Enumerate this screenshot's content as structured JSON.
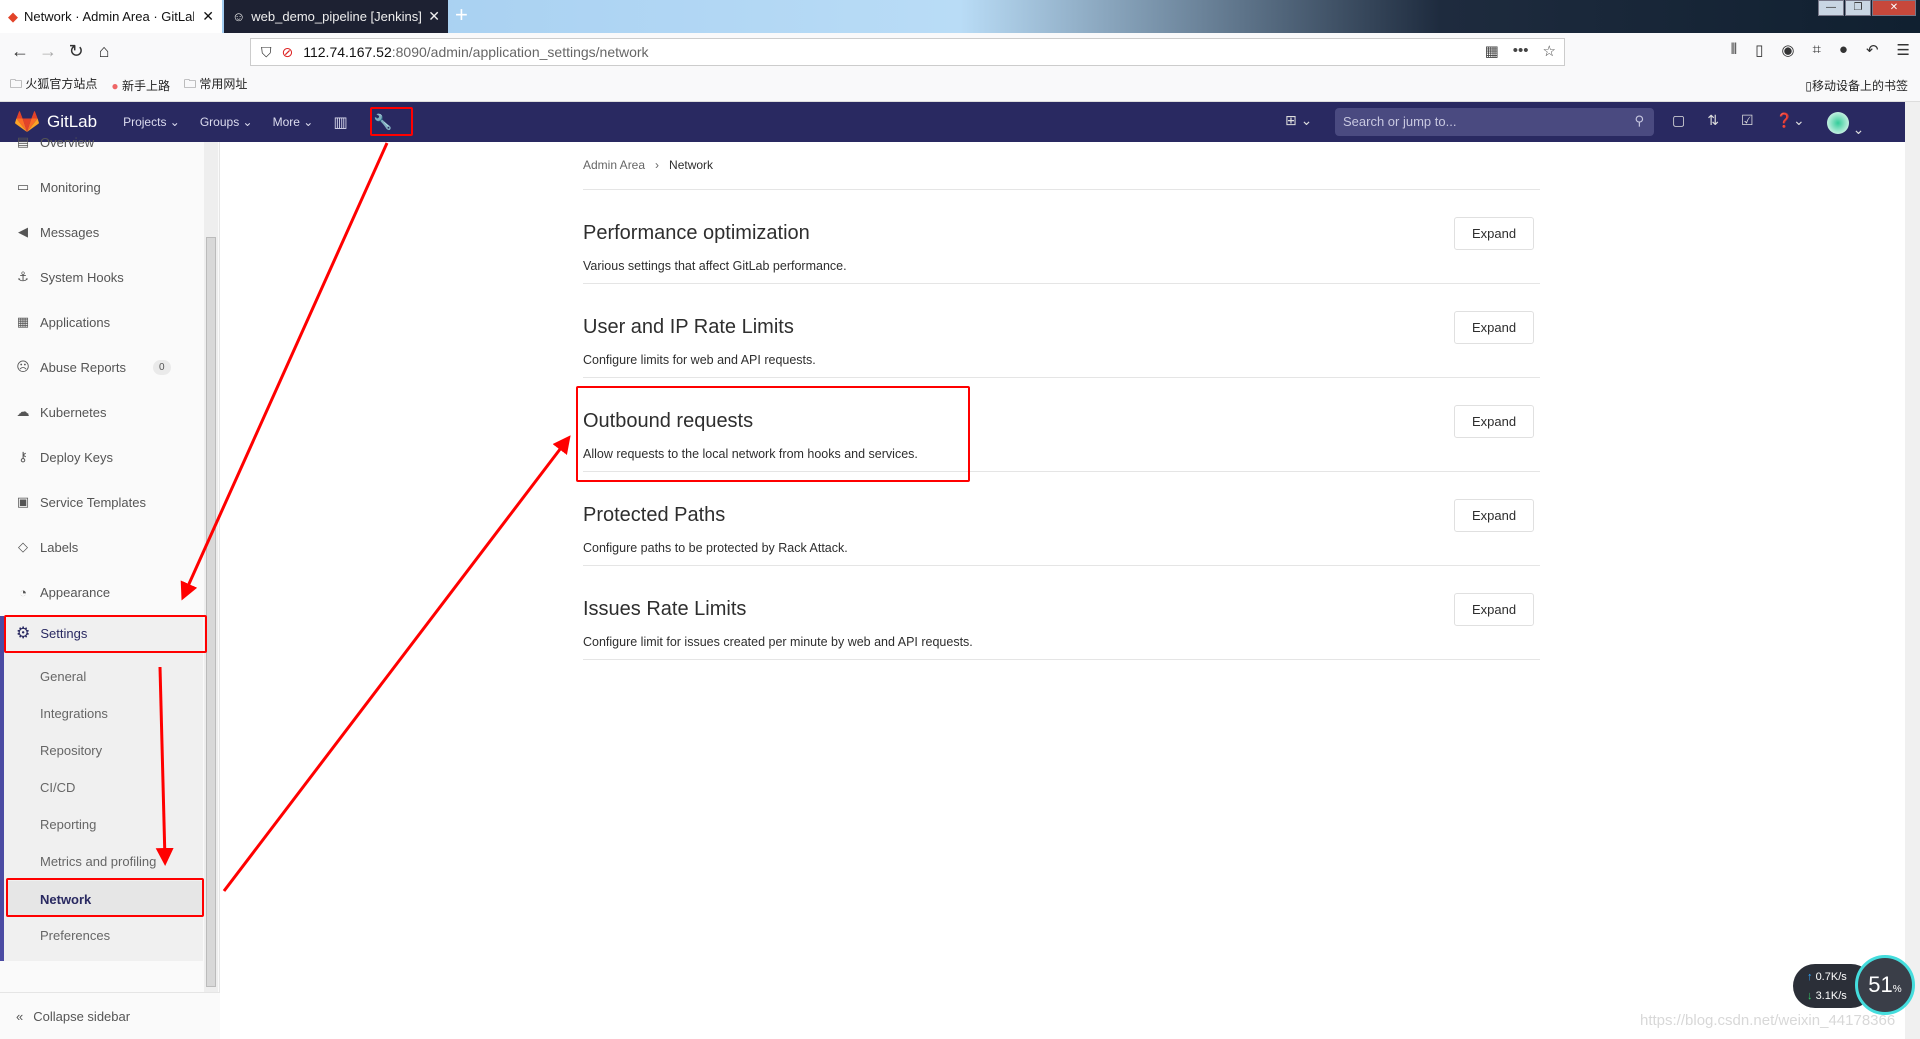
{
  "browser": {
    "tabs": [
      {
        "label": "Network · Admin Area · GitLab",
        "active": true
      },
      {
        "label": "web_demo_pipeline [Jenkins]",
        "active": false
      }
    ],
    "url_host": "112.74.167.52",
    "url_path": ":8090/admin/application_settings/network",
    "bookmarks": [
      "火狐官方站点",
      "新手上路",
      "常用网址"
    ],
    "mobile_bookmarks": "移动设备上的书签"
  },
  "header": {
    "brand": "GitLab",
    "nav": [
      "Projects",
      "Groups",
      "More"
    ],
    "search_placeholder": "Search or jump to..."
  },
  "sidebar": {
    "items": [
      {
        "label": "Overview",
        "icon": "overview-icon"
      },
      {
        "label": "Monitoring",
        "icon": "monitor-icon"
      },
      {
        "label": "Messages",
        "icon": "megaphone-icon"
      },
      {
        "label": "System Hooks",
        "icon": "hook-icon"
      },
      {
        "label": "Applications",
        "icon": "grid-icon"
      },
      {
        "label": "Abuse Reports",
        "icon": "sad-face-icon",
        "badge": "0"
      },
      {
        "label": "Kubernetes",
        "icon": "cloud-gear-icon"
      },
      {
        "label": "Deploy Keys",
        "icon": "key-icon"
      },
      {
        "label": "Service Templates",
        "icon": "template-icon"
      },
      {
        "label": "Labels",
        "icon": "label-icon"
      },
      {
        "label": "Appearance",
        "icon": "palette-icon"
      }
    ],
    "settings_label": "Settings",
    "settings_sub": [
      "General",
      "Integrations",
      "Repository",
      "CI/CD",
      "Reporting",
      "Metrics and profiling",
      "Network",
      "Preferences"
    ],
    "active_sub": "Network",
    "collapse_label": "Collapse sidebar"
  },
  "breadcrumb": [
    "Admin Area",
    "Network"
  ],
  "sections": [
    {
      "title": "Performance optimization",
      "description": "Various settings that affect GitLab performance.",
      "button": "Expand"
    },
    {
      "title": "User and IP Rate Limits",
      "description": "Configure limits for web and API requests.",
      "button": "Expand"
    },
    {
      "title": "Outbound requests",
      "description": "Allow requests to the local network from hooks and services.",
      "button": "Expand"
    },
    {
      "title": "Protected Paths",
      "description": "Configure paths to be protected by Rack Attack.",
      "button": "Expand"
    },
    {
      "title": "Issues Rate Limits",
      "description": "Configure limit for issues created per minute by web and API requests.",
      "button": "Expand"
    }
  ],
  "widget": {
    "upload": "0.7K/s",
    "download": "3.1K/s",
    "percent": "51",
    "percent_sign": "%"
  },
  "watermark": "https://blog.csdn.net/weixin_44178366",
  "annotation_color": "#ff0000",
  "header_color": "#292961"
}
